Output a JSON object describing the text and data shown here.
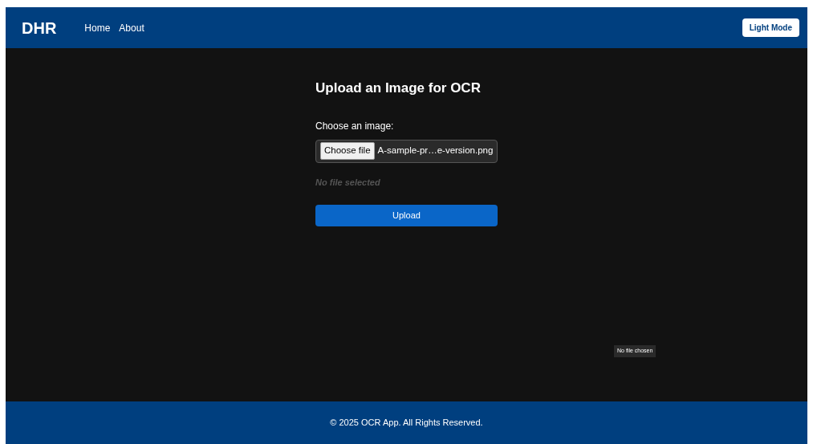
{
  "navbar": {
    "brand": "DHR",
    "links": [
      "Home",
      "About"
    ],
    "theme_button": "Light Mode"
  },
  "upload": {
    "title": "Upload an Image for OCR",
    "label": "Choose an image:",
    "choose_button": "Choose file",
    "file_name": "A-sample-pr…e-version.png",
    "status": "No file selected",
    "submit": "Upload"
  },
  "tooltip": "No file chosen",
  "footer": "© 2025 OCR App. All Rights Reserved."
}
